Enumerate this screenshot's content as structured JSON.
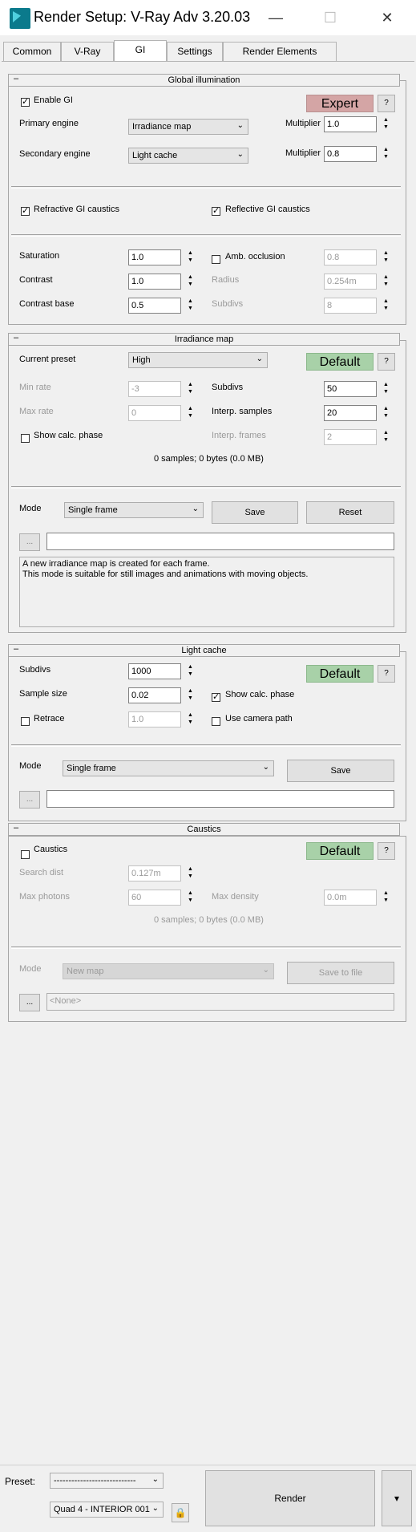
{
  "window": {
    "title": "Render Setup: V-Ray Adv 3.20.03",
    "minimize": "—",
    "maximize": "☐",
    "close": "✕"
  },
  "tabs": [
    "Common",
    "V-Ray",
    "GI",
    "Settings",
    "Render Elements"
  ],
  "active_tab": "GI",
  "rollout_collapse_symbol": "–",
  "global_illumination": {
    "header": "Global illumination",
    "enable_gi": "Enable GI",
    "mode_button": "Expert",
    "help": "?",
    "primary_engine_label": "Primary engine",
    "primary_engine_value": "Irradiance map",
    "multiplier_label": "Multiplier",
    "primary_multiplier": "1.0",
    "secondary_engine_label": "Secondary engine",
    "secondary_engine_value": "Light cache",
    "secondary_multiplier": "0.8",
    "refractive_caustics": "Refractive GI caustics",
    "reflective_caustics": "Reflective GI caustics",
    "saturation_label": "Saturation",
    "saturation": "1.0",
    "contrast_label": "Contrast",
    "contrast": "1.0",
    "contrast_base_label": "Contrast base",
    "contrast_base": "0.5",
    "amb_occlusion_label": "Amb. occlusion",
    "amb_occlusion": "0.8",
    "radius_label": "Radius",
    "radius": "0.254m",
    "subdivs_label": "Subdivs",
    "subdivs": "8"
  },
  "irradiance_map": {
    "header": "Irradiance map",
    "current_preset_label": "Current preset",
    "current_preset": "High",
    "default_button": "Default",
    "help": "?",
    "min_rate_label": "Min rate",
    "min_rate": "-3",
    "max_rate_label": "Max rate",
    "max_rate": "0",
    "subdivs_label": "Subdivs",
    "subdivs": "50",
    "interp_samples_label": "Interp. samples",
    "interp_samples": "20",
    "interp_frames_label": "Interp. frames",
    "interp_frames": "2",
    "show_calc_phase": "Show calc. phase",
    "stats": "0 samples; 0 bytes (0.0 MB)",
    "mode_label": "Mode",
    "mode_value": "Single frame",
    "save_button": "Save",
    "reset_button": "Reset",
    "browse_button": "...",
    "description_line1": "A new irradiance map is created for each frame.",
    "description_line2": "This mode is suitable for still images and animations with moving objects."
  },
  "light_cache": {
    "header": "Light cache",
    "subdivs_label": "Subdivs",
    "subdivs": "1000",
    "sample_size_label": "Sample size",
    "sample_size": "0.02",
    "retrace_label": "Retrace",
    "retrace": "1.0",
    "default_button": "Default",
    "help": "?",
    "show_calc_phase": "Show calc. phase",
    "use_camera_path": "Use camera path",
    "mode_label": "Mode",
    "mode_value": "Single frame",
    "save_button": "Save",
    "browse_button": "..."
  },
  "caustics": {
    "header": "Caustics",
    "caustics_label": "Caustics",
    "default_button": "Default",
    "help": "?",
    "search_dist_label": "Search dist",
    "search_dist": "0.127m",
    "max_photons_label": "Max photons",
    "max_photons": "60",
    "max_density_label": "Max density",
    "max_density": "0.0m",
    "stats": "0 samples; 0 bytes (0.0 MB)",
    "mode_label": "Mode",
    "mode_value": "New map",
    "save_to_file_button": "Save to file",
    "browse_button": "...",
    "file_value": "<None>"
  },
  "footer": {
    "preset_label": "Preset:",
    "preset_value": "----------------------------",
    "view_value": "Quad 4 - INTERIOR 001",
    "render_button": "Render",
    "render_dropdown": "▾"
  },
  "colors": {
    "expert_button": "#d4a5a5",
    "default_button": "#a8d1a8"
  }
}
